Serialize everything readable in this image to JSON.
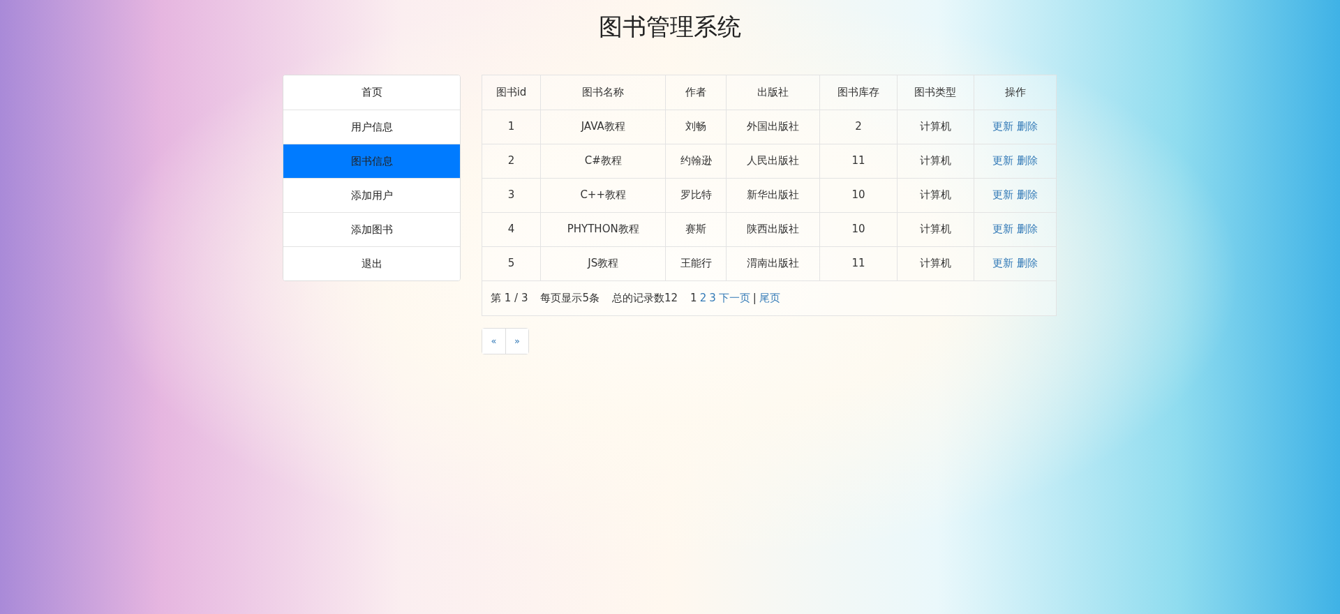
{
  "title": "图书管理系统",
  "sidebar": {
    "items": [
      {
        "label": "首页",
        "selected": false
      },
      {
        "label": "用户信息",
        "selected": false
      },
      {
        "label": "图书信息",
        "selected": true
      },
      {
        "label": "添加用户",
        "selected": false
      },
      {
        "label": "添加图书",
        "selected": false
      },
      {
        "label": "退出",
        "selected": false
      }
    ]
  },
  "table": {
    "columns": [
      "图书id",
      "图书名称",
      "作者",
      "出版社",
      "图书库存",
      "图书类型",
      "操作"
    ],
    "rows": [
      {
        "cells": [
          "1",
          "JAVA教程",
          "刘畅",
          "外国出版社",
          "2",
          "计算机"
        ],
        "actions": [
          "更新",
          "删除"
        ]
      },
      {
        "cells": [
          "2",
          "C#教程",
          "约翰逊",
          "人民出版社",
          "11",
          "计算机"
        ],
        "actions": [
          "更新",
          "删除"
        ]
      },
      {
        "cells": [
          "3",
          "C++教程",
          "罗比特",
          "新华出版社",
          "10",
          "计算机"
        ],
        "actions": [
          "更新",
          "删除"
        ]
      },
      {
        "cells": [
          "4",
          "PHYTHON教程",
          "赛斯",
          "陕西出版社",
          "10",
          "计算机"
        ],
        "actions": [
          "更新",
          "删除"
        ]
      },
      {
        "cells": [
          "5",
          "JS教程",
          "王能行",
          "渭南出版社",
          "11",
          "计算机"
        ],
        "actions": [
          "更新",
          "删除"
        ]
      }
    ],
    "footer": {
      "page_info": "第 1 / 3",
      "per_page": "每页显示5条",
      "total": "总的记录数12",
      "pages": [
        {
          "label": "1",
          "selected": true
        },
        {
          "label": "2",
          "selected": false
        },
        {
          "label": "3",
          "selected": false
        }
      ],
      "next": "下一页",
      "separator": "|",
      "last": "尾页"
    }
  },
  "pager": [
    "«",
    "»"
  ]
}
